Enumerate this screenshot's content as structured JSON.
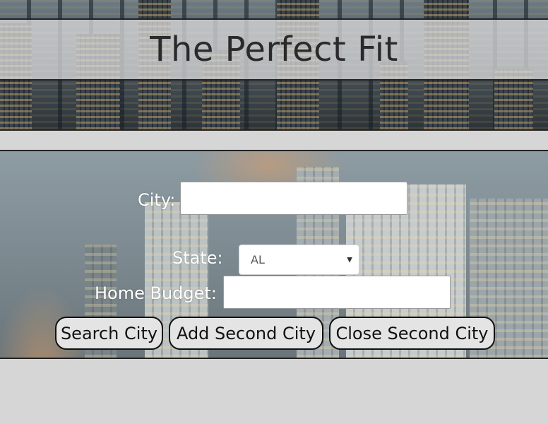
{
  "header": {
    "title": "The Perfect Fit"
  },
  "form": {
    "city": {
      "label": "City:",
      "value": ""
    },
    "state": {
      "label": "State:",
      "selected": "AL"
    },
    "budget": {
      "label": "Home Budget:",
      "value": ""
    }
  },
  "buttons": {
    "search": "Search City",
    "add_second": "Add Second City",
    "close_second": "Close Second City"
  },
  "icons": {
    "select_caret": "chevron-down-icon",
    "select_caret_glyph": "▼"
  },
  "colors": {
    "page_background": "#d6d6d6",
    "title_band": "#dedede",
    "title_text": "#2a2a2a",
    "label_text": "#ffffff",
    "button_fill": "#e4e4e4",
    "border": "#222222"
  }
}
